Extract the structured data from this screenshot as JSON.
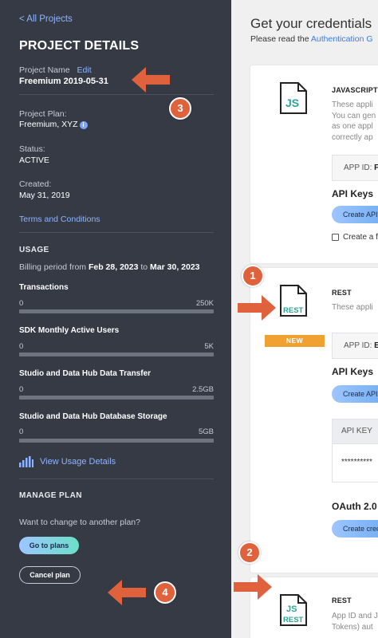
{
  "sidebar": {
    "back_link": "< All Projects",
    "title": "PROJECT DETAILS",
    "project_name_label": "Project Name",
    "edit_link": "Edit",
    "project_name_value": "Freemium 2019-05-31",
    "plan_label": "Project Plan:",
    "plan_value": "Freemium, XYZ",
    "status_label": "Status:",
    "status_value": "ACTIVE",
    "created_label": "Created:",
    "created_value": "May 31, 2019",
    "terms_link": "Terms and Conditions",
    "usage_heading": "USAGE",
    "billing_prefix": "Billing period from",
    "billing_from": "Feb 28, 2023",
    "billing_to_word": "to",
    "billing_to": "Mar 30, 2023",
    "usage_items": [
      {
        "name": "Transactions",
        "min": "0",
        "max": "250K",
        "fill": 0
      },
      {
        "name": "SDK Monthly Active Users",
        "min": "0",
        "max": "5K",
        "fill": 0
      },
      {
        "name": "Studio and Data Hub Data Transfer",
        "min": "0",
        "max": "2.5GB",
        "fill": 0
      },
      {
        "name": "Studio and Data Hub Database Storage",
        "min": "0",
        "max": "5GB",
        "fill": 0
      }
    ],
    "view_usage_link": "View Usage Details",
    "manage_heading": "MANAGE PLAN",
    "change_question": "Want to change to another plan?",
    "go_to_plans": "Go to plans",
    "cancel_plan": "Cancel plan"
  },
  "main": {
    "title": "Get your credentials",
    "subtitle_prefix": "Please read the",
    "subtitle_link": "Authentication G",
    "cards": [
      {
        "icon_text": "JS",
        "heading": "JAVASCRIPT",
        "desc_lines": [
          "These appli",
          "You can gen",
          "as one appl",
          "correctly ap"
        ],
        "app_id_label": "APP ID:",
        "app_id_value": "F",
        "api_keys_label": "API Keys",
        "create_button": "Create API",
        "checkbox_label": "Create a f"
      },
      {
        "icon_text": "REST",
        "badge": "NEW",
        "heading": "REST",
        "desc_lines": [
          "These appli"
        ],
        "app_id_label": "APP ID:",
        "app_id_value": "E",
        "api_keys_label": "API Keys",
        "create_button": "Create API",
        "table_header": "API KEY",
        "table_value": "**********",
        "oauth_label": "OAuth 2.0",
        "oauth_button": "Create cred"
      },
      {
        "icon_text_top": "JS",
        "icon_text_bottom": "REST",
        "heading": "REST",
        "desc_lines": [
          "App ID and J",
          "Tokens) aut"
        ]
      }
    ]
  },
  "annotations": [
    "1",
    "2",
    "3",
    "4"
  ],
  "colors": {
    "sidebar_bg": "#353a45",
    "link": "#8fb4ff",
    "annotation": "#e0623d",
    "new_badge": "#f0a12f",
    "icon_teal": "#2ba39a"
  }
}
